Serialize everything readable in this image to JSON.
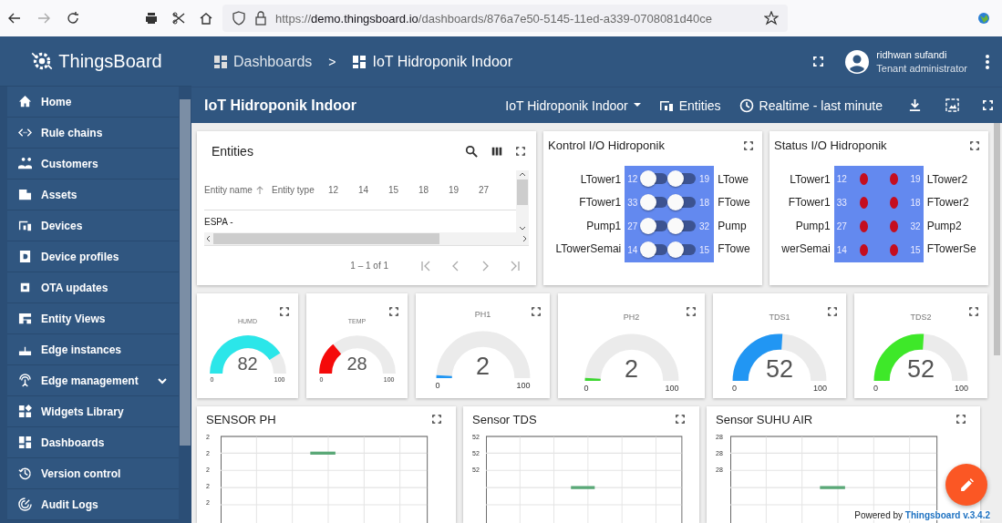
{
  "browser": {
    "url": "https://**demo.thingsboard.io**/dashboards/876a7e50-5145-11ed-a339-0708081d40ce"
  },
  "app_bar": {
    "logo": "ThingsBoard",
    "breadcrumb": [
      "Dashboards",
      ">",
      "IoT Hidroponik Indoor"
    ],
    "user_name": "ridhwan sufandi",
    "user_role": "Tenant administrator"
  },
  "sidebar": {
    "items": [
      {
        "label": "Home",
        "kind": "link"
      },
      {
        "label": "Rule chains",
        "kind": "link"
      },
      {
        "label": "Customers",
        "kind": "link"
      },
      {
        "label": "Assets",
        "kind": "link"
      },
      {
        "label": "Devices",
        "kind": "link"
      },
      {
        "label": "Device profiles",
        "kind": "link"
      },
      {
        "label": "OTA updates",
        "kind": "link"
      },
      {
        "label": "Entity Views",
        "kind": "link"
      },
      {
        "label": "Edge instances",
        "kind": "link"
      },
      {
        "label": "Edge management",
        "kind": "group",
        "expanded": false
      },
      {
        "label": "Widgets Library",
        "kind": "link"
      },
      {
        "label": "Dashboards",
        "kind": "link"
      },
      {
        "label": "Version control",
        "kind": "link"
      },
      {
        "label": "Audit Logs",
        "kind": "link"
      }
    ]
  },
  "toolbar": {
    "title": "IoT Hidroponik Indoor",
    "state": "IoT Hidroponik Indoor",
    "entities": "Entities",
    "timewindow": "Realtime - last minute"
  },
  "entities_widget": {
    "title": "Entities",
    "columns": [
      {
        "label": "Entity name",
        "sorted": true
      },
      {
        "label": "Entity type",
        "sorted": false
      },
      {
        "label": "12",
        "sorted": false
      },
      {
        "label": "14",
        "sorted": false
      },
      {
        "label": "15",
        "sorted": false
      },
      {
        "label": "18",
        "sorted": false
      },
      {
        "label": "19",
        "sorted": false
      },
      {
        "label": "27",
        "sorted": false
      }
    ],
    "rows": [
      [
        "ESPA -"
      ]
    ],
    "paginator": "1 – 1 of 1"
  },
  "control_widget": {
    "title": "Kontrol I/O Hidroponik",
    "rows": [
      {
        "left": {
          "label": "LTower1",
          "pin": "12",
          "on": false
        },
        "right": {
          "label": "LTowe",
          "pin": "19",
          "on": false
        }
      },
      {
        "left": {
          "label": "FTower1",
          "pin": "33",
          "on": false
        },
        "right": {
          "label": "FTowe",
          "pin": "18",
          "on": false
        }
      },
      {
        "left": {
          "label": "Pump1",
          "pin": "27",
          "on": false
        },
        "right": {
          "label": "Pump",
          "pin": "32",
          "on": false
        }
      },
      {
        "left": {
          "label": "LTowerSemai",
          "pin": "14",
          "on": false
        },
        "right": {
          "label": "FTowe",
          "pin": "15",
          "on": false
        }
      }
    ]
  },
  "status_widget": {
    "title": "Status I/O Hidroponik",
    "rows": [
      {
        "left": {
          "label": "LTower1",
          "pin": "12",
          "on": false
        },
        "right": {
          "label": "LTower2",
          "pin": "19",
          "on": false
        }
      },
      {
        "left": {
          "label": "FTower1",
          "pin": "33",
          "on": false
        },
        "right": {
          "label": "FTower2",
          "pin": "18",
          "on": false
        }
      },
      {
        "left": {
          "label": "Pump1",
          "pin": "27",
          "on": false
        },
        "right": {
          "label": "Pump2",
          "pin": "32",
          "on": false
        }
      },
      {
        "left": {
          "label": "werSemai",
          "pin": "14",
          "on": false
        },
        "right": {
          "label": "FTowerSe",
          "pin": "15",
          "on": false
        }
      }
    ]
  },
  "gauges": [
    {
      "title": "HUMD",
      "value": "82",
      "min": "0",
      "max": "100",
      "color": "#2be6e9"
    },
    {
      "title": "TEMP",
      "value": "28",
      "min": "0",
      "max": "100",
      "color": "#f50a0a"
    },
    {
      "title": "PH1",
      "value": "2",
      "min": "0",
      "max": "100",
      "color": "#2196f3"
    },
    {
      "title": "PH2",
      "value": "2",
      "min": "0",
      "max": "100",
      "color": "#3cd630"
    },
    {
      "title": "TDS1",
      "value": "52",
      "min": "0",
      "max": "100",
      "color": "#2196f3"
    },
    {
      "title": "TDS2",
      "value": "52",
      "min": "0",
      "max": "100",
      "color": "#3ee829"
    }
  ],
  "charts": [
    {
      "title": "SENSOR PH",
      "y_tick_labels": [
        "2",
        "2",
        "2",
        "2",
        "2"
      ]
    },
    {
      "title": "Sensor TDS",
      "y_tick_labels": [
        "52",
        "52",
        "52"
      ]
    },
    {
      "title": "Sensor SUHU AIR",
      "y_tick_labels": [
        "28",
        "28",
        "28"
      ]
    }
  ],
  "footer": {
    "prefix": "Powered by",
    "link": "Thingsboard v.3.4.2"
  }
}
